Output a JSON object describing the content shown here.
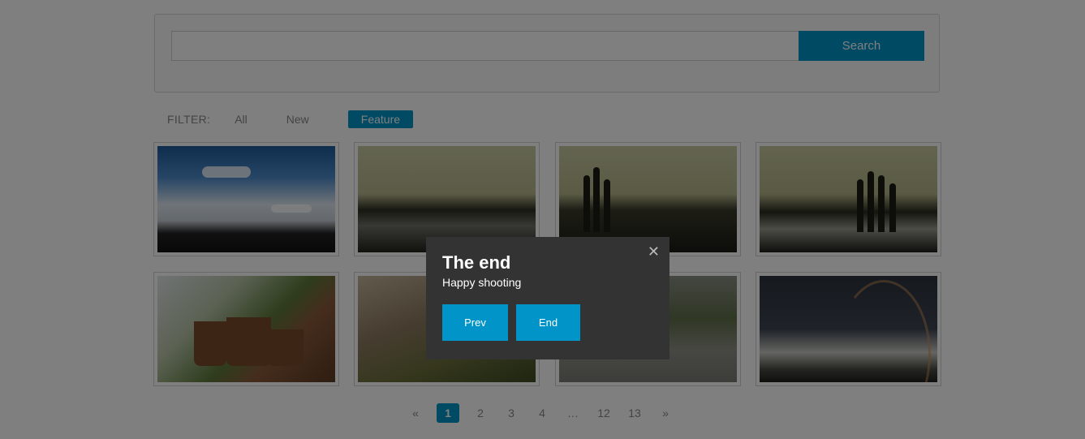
{
  "search": {
    "button_label": "Search",
    "placeholder": ""
  },
  "filter": {
    "label": "FILTER:",
    "items": [
      "All",
      "New",
      "Feature"
    ],
    "active": "Feature"
  },
  "gallery": {
    "photos": [
      "sky",
      "rooftop-1",
      "rooftop-2",
      "rooftop-3",
      "plant-pots",
      "wall-plants",
      "balcony",
      "rainbow"
    ]
  },
  "pagination": {
    "prev": "«",
    "pages": [
      "1",
      "2",
      "3",
      "4",
      "…",
      "12",
      "13"
    ],
    "next": "»",
    "current": "1"
  },
  "modal": {
    "close_symbol": "✕",
    "title": "The end",
    "subtitle": "Happy shooting",
    "prev_label": "Prev",
    "end_label": "End"
  },
  "colors": {
    "accent": "#0094c8",
    "modal_bg": "#333333",
    "overlay": "rgba(0,0,0,0.5)"
  }
}
